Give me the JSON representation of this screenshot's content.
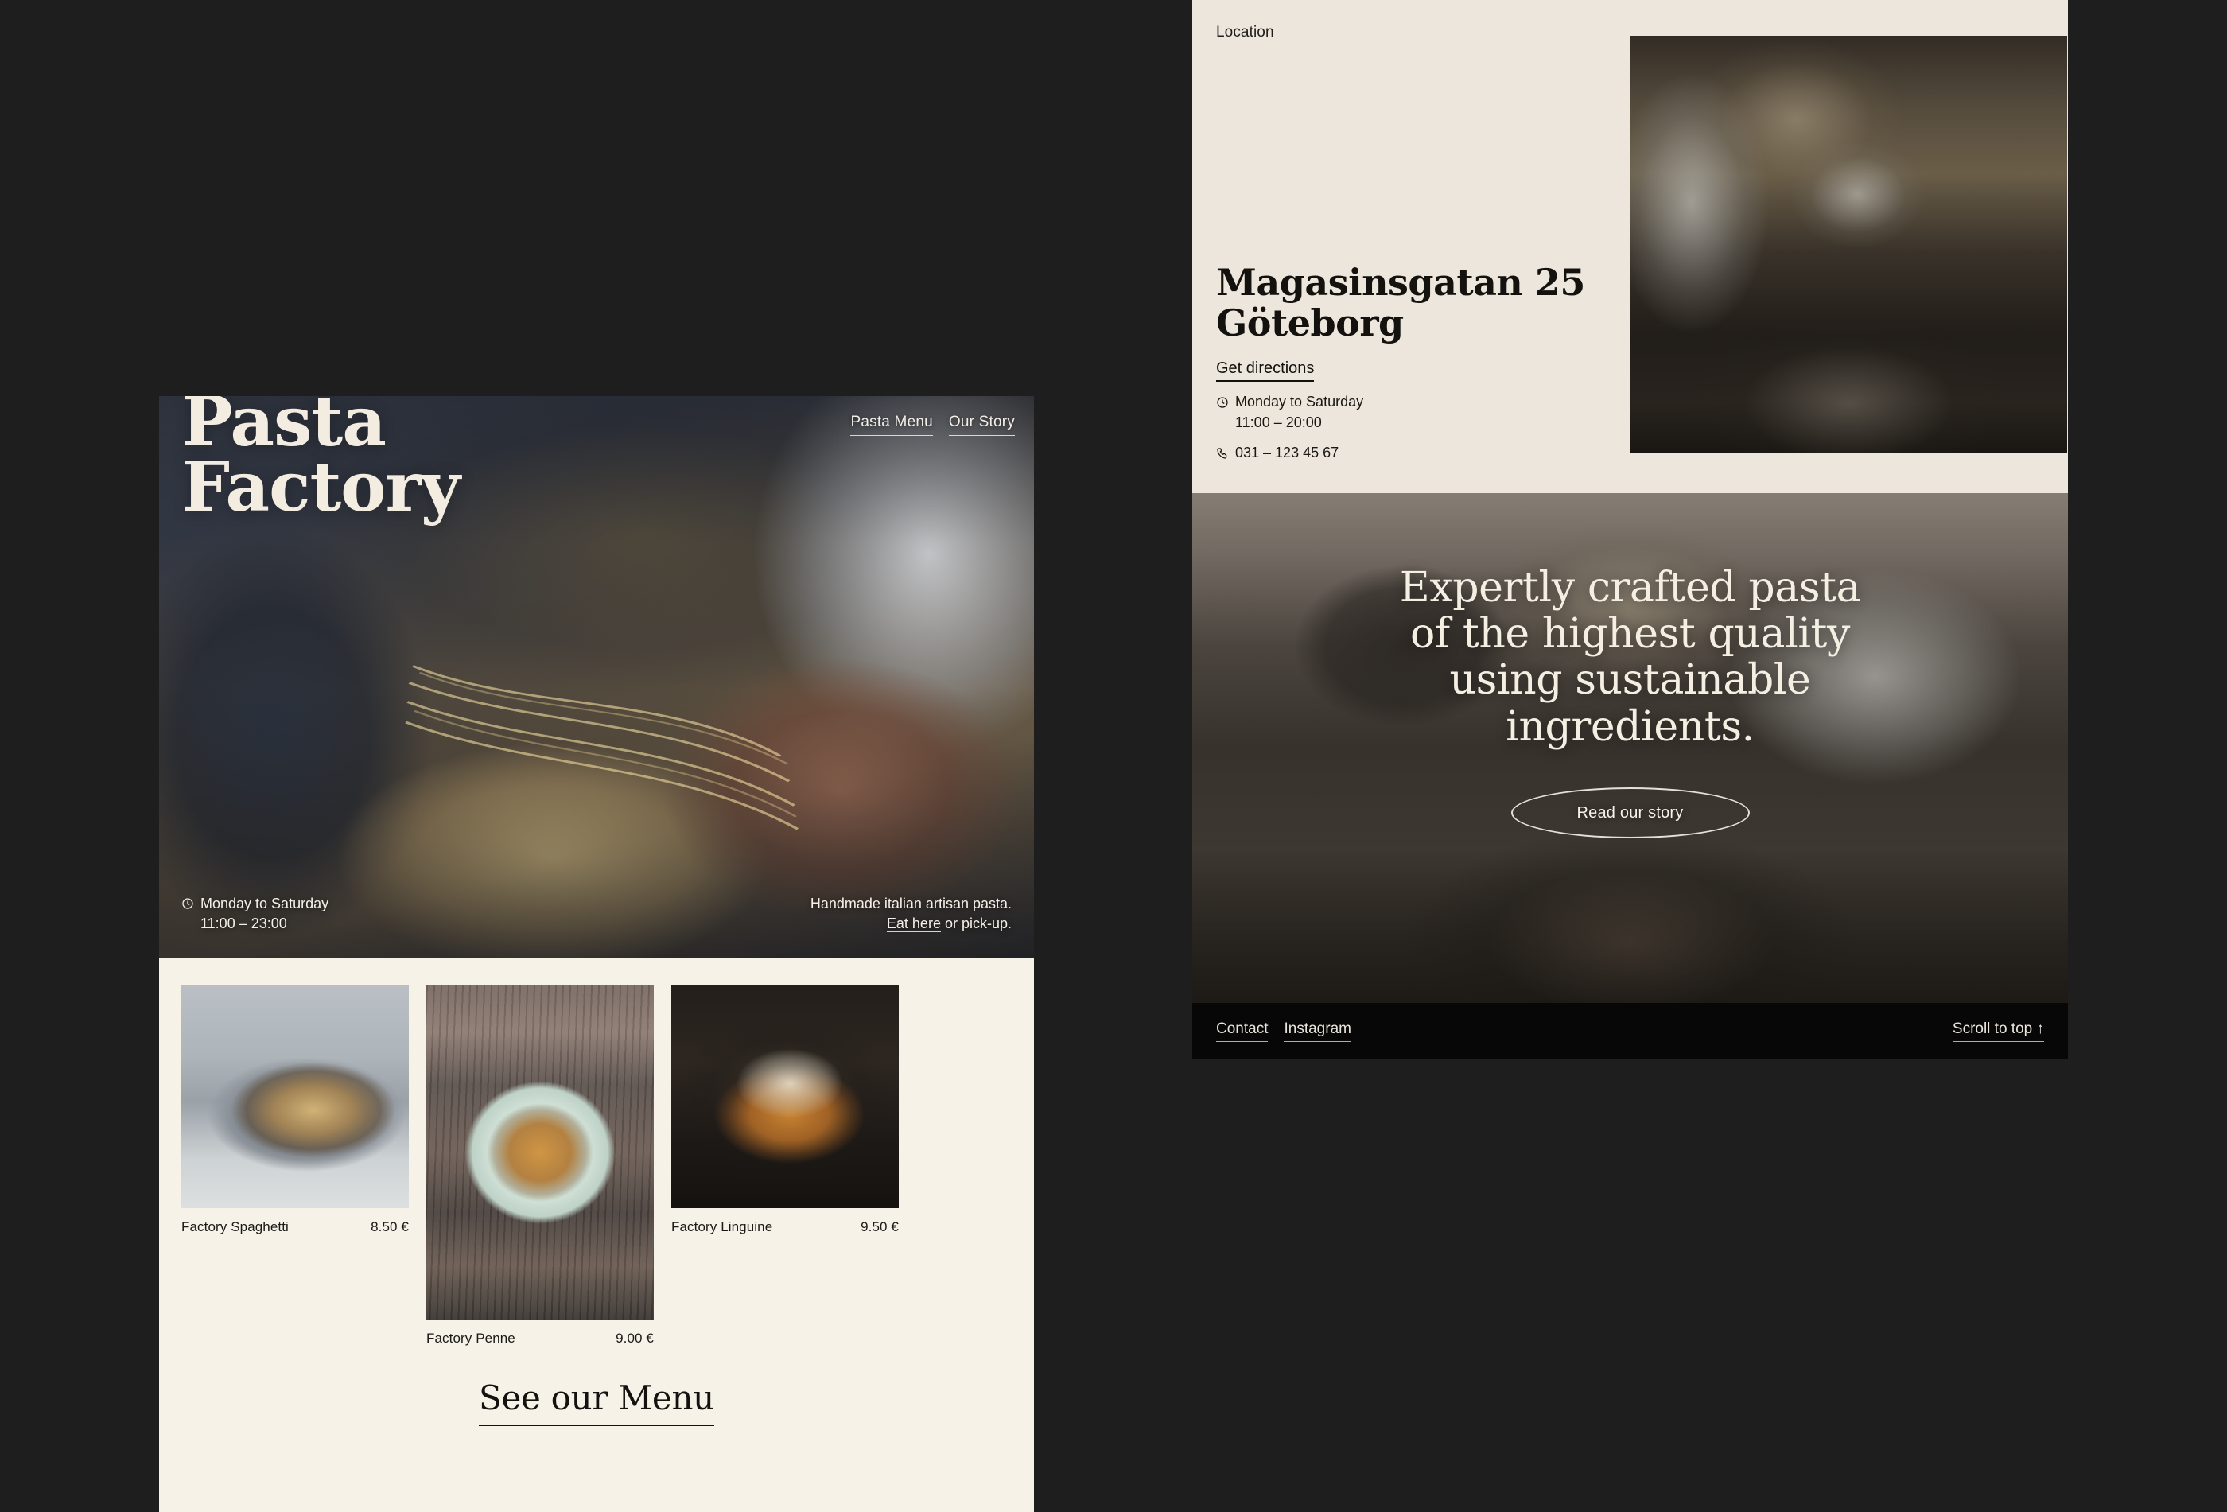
{
  "theme": {
    "page_background": "#1e1e1e",
    "panel_cream": "#f6f2e8",
    "panel_beige": "#ece6dc",
    "ink": "#14120f",
    "footer_black": "#070707",
    "light_text": "#f4f0e7"
  },
  "left_panel": {
    "hero": {
      "title_line1": "Pasta",
      "title_line2": "Factory",
      "nav": [
        {
          "label": "Pasta Menu"
        },
        {
          "label": "Our Story"
        }
      ],
      "hours_icon": "clock-icon",
      "hours_days": "Monday to Saturday",
      "hours_time": "11:00 – 23:00",
      "tagline": "Handmade italian artisan pasta.",
      "order_link": "Eat here",
      "order_rest": " or pick-up."
    },
    "menu": {
      "items": [
        {
          "name": "Factory Spaghetti",
          "price": "8.50 €",
          "image": "spaghetti-photo"
        },
        {
          "name": "Factory Penne",
          "price": "9.00 €",
          "image": "penne-photo"
        },
        {
          "name": "Factory Linguine",
          "price": "9.50 €",
          "image": "linguine-photo"
        }
      ],
      "cta": "See our Menu"
    }
  },
  "right_panel": {
    "location": {
      "label": "Location",
      "address_line1": "Magasinsgatan 25",
      "address_line2": "Göteborg",
      "directions_link": "Get directions",
      "hours_icon": "clock-icon",
      "hours_days": "Monday to Saturday",
      "hours_time": "11:00 – 20:00",
      "phone_icon": "phone-icon",
      "phone": "031 – 123 45 67",
      "photo": "restaurant-interior-photo"
    },
    "story": {
      "quote_line1": "Expertly crafted pasta",
      "quote_line2": "of the highest quality",
      "quote_line3": "using sustainable",
      "quote_line4": "ingredients.",
      "cta": "Read our story",
      "photo": "outdoor-terrace-photo"
    },
    "footer": {
      "links": [
        {
          "label": "Contact"
        },
        {
          "label": "Instagram"
        }
      ],
      "scroll_top": "Scroll to top ↑"
    }
  }
}
